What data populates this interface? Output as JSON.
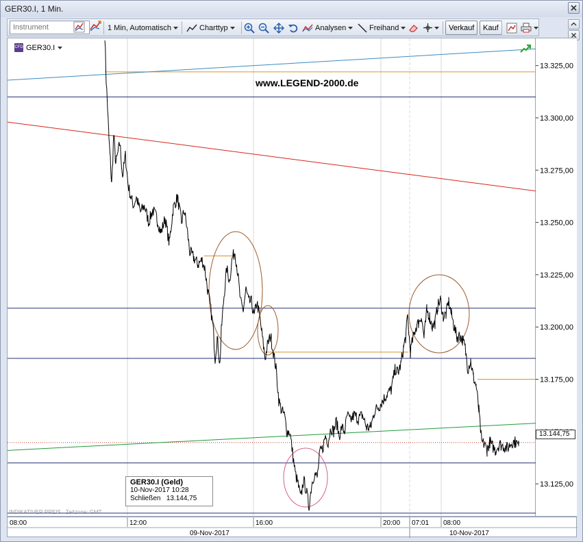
{
  "window": {
    "title": "GER30.I, 1 Min."
  },
  "toolbar": {
    "instrument_placeholder": "Instrument",
    "interval_label": "1 Min,  Automatisch",
    "charttype_label": "Charttyp",
    "analysen_label": "Analysen",
    "freihand_label": "Freihand",
    "verkauf_label": "Verkauf",
    "kauf_label": "Kauf"
  },
  "chart": {
    "instrument": "GER30.I",
    "watermark": "www.LEGEND-2000.de",
    "indicator_note": "INDIKATIVER PREIS",
    "timezone_note": "Zeitzone: GMT",
    "current_price": "13.144,75",
    "colors": {
      "price": "#000000",
      "navy": "#26307a",
      "orange": "#d9902a",
      "red": "#d8231c",
      "blue": "#3a8bbf",
      "green": "#1e9a3a",
      "ellipse": "#9b5a2c",
      "ellipse_low": "#d6607e"
    }
  },
  "infobox": {
    "title": "GER30.I (Geld)",
    "datetime": "10-Nov-2017 10:28",
    "close_label": "Schließen",
    "close_value": "13.144,75"
  },
  "chart_data": {
    "type": "line",
    "y_ticks": [
      "13.325,00",
      "13.300,00",
      "13.275,00",
      "13.250,00",
      "13.225,00",
      "13.200,00",
      "13.175,00",
      "13.150,00",
      "13.125,00"
    ],
    "ylim": [
      13109,
      13338
    ],
    "x_ticks": [
      "08:00",
      "12:00",
      "16:00",
      "20:00",
      "07:01",
      "08:00"
    ],
    "date_labels": [
      "09-Nov-2017",
      "10-Nov-2017"
    ],
    "last_value": 13144.75
  }
}
